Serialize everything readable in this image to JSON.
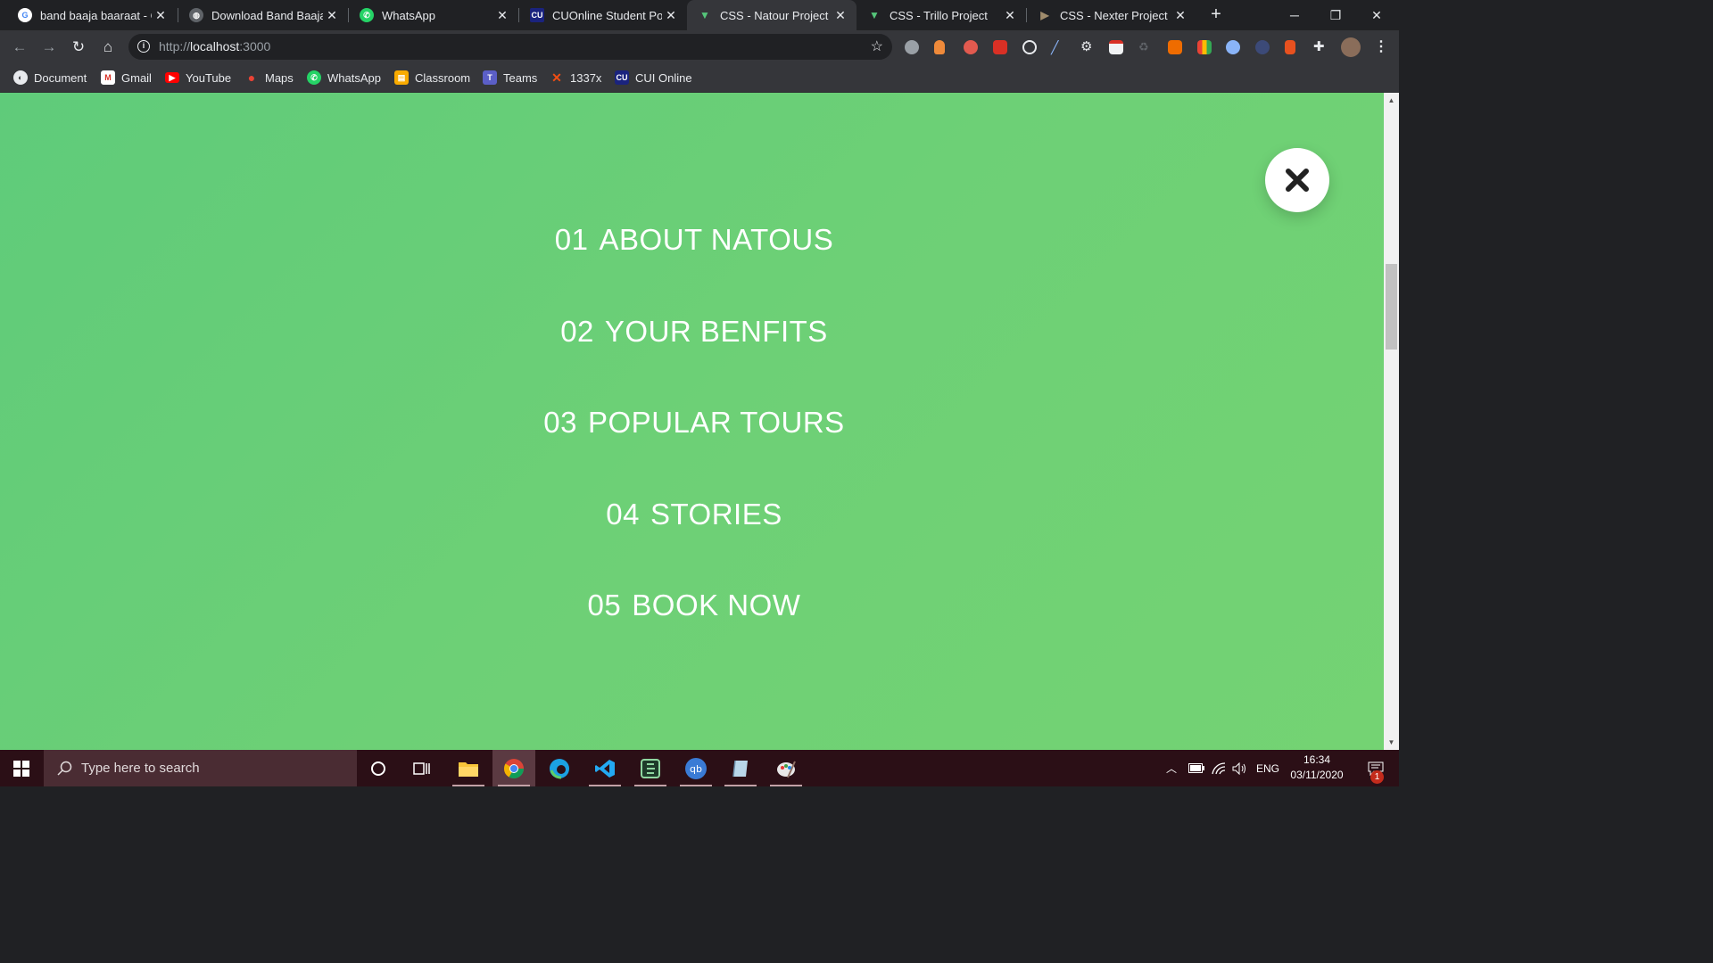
{
  "browser": {
    "tabs": [
      {
        "title": "band baaja baaraat - G",
        "favicon": "google-icon",
        "active": false
      },
      {
        "title": "Download Band Baaja B",
        "favicon": "globe-icon",
        "active": false
      },
      {
        "title": "WhatsApp",
        "favicon": "whatsapp-icon",
        "active": false
      },
      {
        "title": "CUOnline Student Port",
        "favicon": "cui-icon",
        "active": false
      },
      {
        "title": "CSS - Natour Project",
        "favicon": "natours-icon",
        "active": true
      },
      {
        "title": "CSS - Trillo Project",
        "favicon": "natours-icon",
        "active": false
      },
      {
        "title": "CSS - Nexter Project",
        "favicon": "nexter-icon",
        "active": false
      }
    ],
    "address": {
      "scheme": "http://",
      "host": "localhost",
      "port": ":3000"
    },
    "bookmarks": [
      {
        "label": "Document",
        "icon": "document-icon"
      },
      {
        "label": "Gmail",
        "icon": "gmail-icon"
      },
      {
        "label": "YouTube",
        "icon": "youtube-icon"
      },
      {
        "label": "Maps",
        "icon": "maps-icon"
      },
      {
        "label": "WhatsApp",
        "icon": "whatsapp-icon"
      },
      {
        "label": "Classroom",
        "icon": "classroom-icon"
      },
      {
        "label": "Teams",
        "icon": "teams-icon"
      },
      {
        "label": "1337x",
        "icon": "1337x-icon"
      },
      {
        "label": "CUI Online",
        "icon": "cui-icon"
      }
    ]
  },
  "page": {
    "background_color": "#6dd076",
    "nav_items": [
      {
        "number": "01",
        "label": "ABOUT NATOUS"
      },
      {
        "number": "02",
        "label": "YOUR BENFITS"
      },
      {
        "number": "03",
        "label": "POPULAR TOURS"
      },
      {
        "number": "04",
        "label": "STORIES"
      },
      {
        "number": "05",
        "label": "BOOK NOW"
      }
    ],
    "close_button_icon": "close-x-icon"
  },
  "taskbar": {
    "search_placeholder": "Type here to search",
    "language": "ENG",
    "time": "16:34",
    "date": "03/11/2020",
    "notification_count": "1"
  }
}
